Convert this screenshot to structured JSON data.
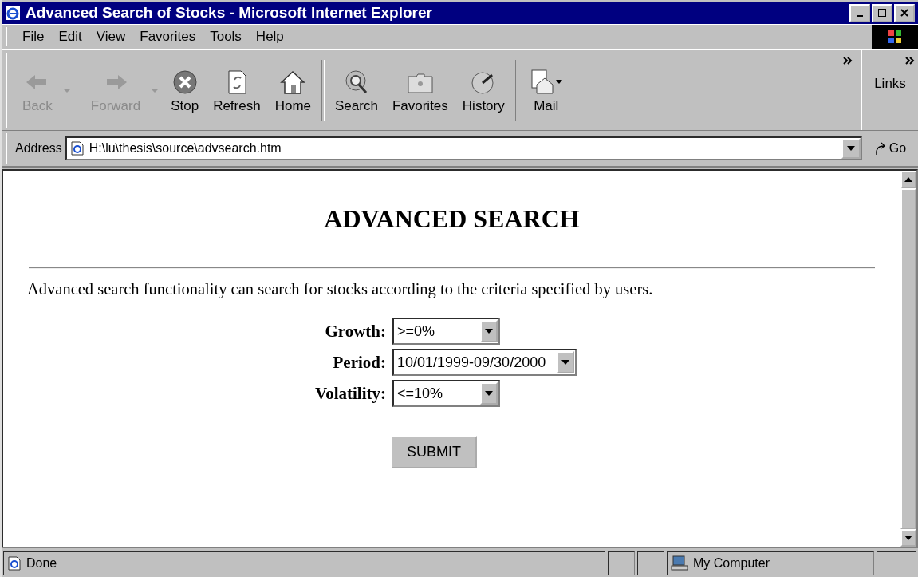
{
  "window": {
    "title": "Advanced Search of Stocks - Microsoft Internet Explorer"
  },
  "menu": [
    "File",
    "Edit",
    "View",
    "Favorites",
    "Tools",
    "Help"
  ],
  "toolbar": [
    {
      "kind": "back",
      "label": "Back",
      "disabled": true
    },
    {
      "kind": "forward",
      "label": "Forward",
      "disabled": true
    },
    {
      "kind": "stop",
      "label": "Stop",
      "disabled": false
    },
    {
      "kind": "refresh",
      "label": "Refresh",
      "disabled": false
    },
    {
      "kind": "home",
      "label": "Home",
      "disabled": false
    },
    {
      "kind": "search",
      "label": "Search",
      "disabled": false
    },
    {
      "kind": "favorites",
      "label": "Favorites",
      "disabled": false
    },
    {
      "kind": "history",
      "label": "History",
      "disabled": false
    },
    {
      "kind": "mail",
      "label": "Mail",
      "disabled": false
    }
  ],
  "links": {
    "label": "Links"
  },
  "address": {
    "label": "Address",
    "value": "H:\\lu\\thesis\\source\\advsearch.htm",
    "go": "Go"
  },
  "page": {
    "heading": "ADVANCED SEARCH",
    "intro": "Advanced search functionality can search for stocks according to the criteria specified by users.",
    "fields": [
      {
        "label": "Growth:",
        "value": ">=0%"
      },
      {
        "label": "Period:",
        "value": "10/01/1999-09/30/2000"
      },
      {
        "label": "Volatility:",
        "value": "<=10%"
      }
    ],
    "submit": "SUBMIT"
  },
  "status_bar": {
    "text": "Done",
    "zone": "My Computer"
  }
}
